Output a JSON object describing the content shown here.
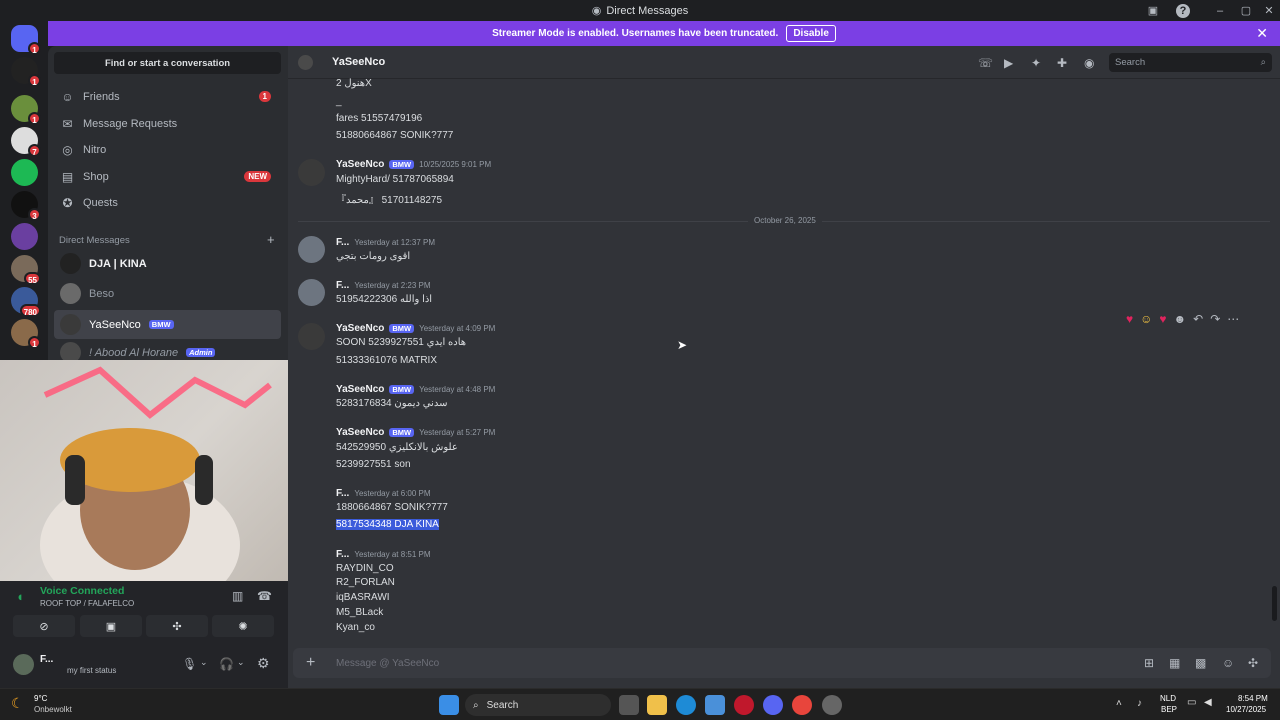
{
  "titlebar": {
    "title": "Direct Messages"
  },
  "banner": {
    "text": "Streamer Mode is enabled. Usernames have been truncated.",
    "disable": "Disable"
  },
  "servers": [
    {
      "badge": "1",
      "color": "#5865f2"
    },
    {
      "badge": "1",
      "color": "#222"
    },
    {
      "badge": "1",
      "color": "#6a8f3c"
    },
    {
      "badge": "7",
      "color": "#ddd"
    },
    {
      "badge": "",
      "color": "#1db954"
    },
    {
      "badge": "3",
      "color": "#111"
    },
    {
      "badge": "",
      "color": "#6a3fa0"
    },
    {
      "badge": "55",
      "color": "#7a6a5a"
    },
    {
      "badge": "780",
      "color": "#3a5a9a"
    },
    {
      "badge": "1",
      "color": "#8a6a4a"
    }
  ],
  "sidebar": {
    "search": "Find or start a conversation",
    "nav": [
      {
        "label": "Friends",
        "icon": "friends-icon",
        "badge": "1"
      },
      {
        "label": "Message Requests",
        "icon": "mail-icon",
        "badge": ""
      },
      {
        "label": "Nitro",
        "icon": "nitro-icon",
        "badge": ""
      },
      {
        "label": "Shop",
        "icon": "shop-icon",
        "badge": "NEW"
      },
      {
        "label": "Quests",
        "icon": "quests-icon",
        "badge": ""
      }
    ],
    "dm_header": "Direct Messages",
    "dms": [
      {
        "name": "DJA | KINA",
        "tag": ""
      },
      {
        "name": "Beso",
        "tag": ""
      },
      {
        "name": "YaSeeNco",
        "tag": "BMW"
      },
      {
        "name": "! Abood Al Horane",
        "tag": "Admin"
      }
    ]
  },
  "voice": {
    "status": "Voice Connected",
    "channel": "ROOF TOP / FALAFELCO"
  },
  "user": {
    "name": "F...",
    "status": "my first status"
  },
  "chat": {
    "recipient": "YaSeeNco",
    "search_placeholder": "Search",
    "date_separator": "October 26, 2025",
    "composer_placeholder": "Message @ YaSeeNco",
    "top_lines": [
      "هنول 2X",
      "_",
      "fares 51557479196",
      "51880664867 SONIK?777"
    ],
    "messages": [
      {
        "author": "YaSeeNco",
        "tag": "BMW",
        "time": "10/25/2025 9:01 PM",
        "lines": [
          "MightyHard/ 51787065894",
          "『محمد』 51701148275"
        ]
      },
      {
        "author": "F...",
        "tag": "",
        "time": "Yesterday at 12:37 PM",
        "lines": [
          "اقوى رومات بتجي"
        ]
      },
      {
        "author": "F...",
        "tag": "",
        "time": "Yesterday at 2:23 PM",
        "lines": [
          "51954222306 اذا والله"
        ]
      },
      {
        "author": "YaSeeNco",
        "tag": "BMW",
        "time": "Yesterday at 4:09 PM",
        "lines": [
          "SOON هاده ايدي 5239927551",
          "51333361076 MATRIX"
        ]
      },
      {
        "author": "YaSeeNco",
        "tag": "BMW",
        "time": "Yesterday at 4:48 PM",
        "lines": [
          "5283176834 سدني ديمون"
        ]
      },
      {
        "author": "YaSeeNco",
        "tag": "BMW",
        "time": "Yesterday at 5:27 PM",
        "lines": [
          "542529950 علوش بالانكليزي",
          "5239927551 son"
        ]
      },
      {
        "author": "F...",
        "tag": "",
        "time": "Yesterday at 6:00 PM",
        "lines": [
          "1880664867 SONIK?777",
          "5817534348 DJA KINA"
        ]
      },
      {
        "author": "F...",
        "tag": "",
        "time": "Yesterday at 8:51 PM",
        "lines": [
          "RAYDIN_CO",
          "R2_FORLAN",
          "iqBASRAWI",
          "M5_BLack",
          "Kyan_co"
        ]
      }
    ]
  },
  "taskbar": {
    "weather_temp": "9°C",
    "weather_desc": "Onbewolkt",
    "search": "Search",
    "lang": "NLD",
    "layout": "BEP",
    "time": "8:54 PM",
    "date": "10/27/2025"
  }
}
